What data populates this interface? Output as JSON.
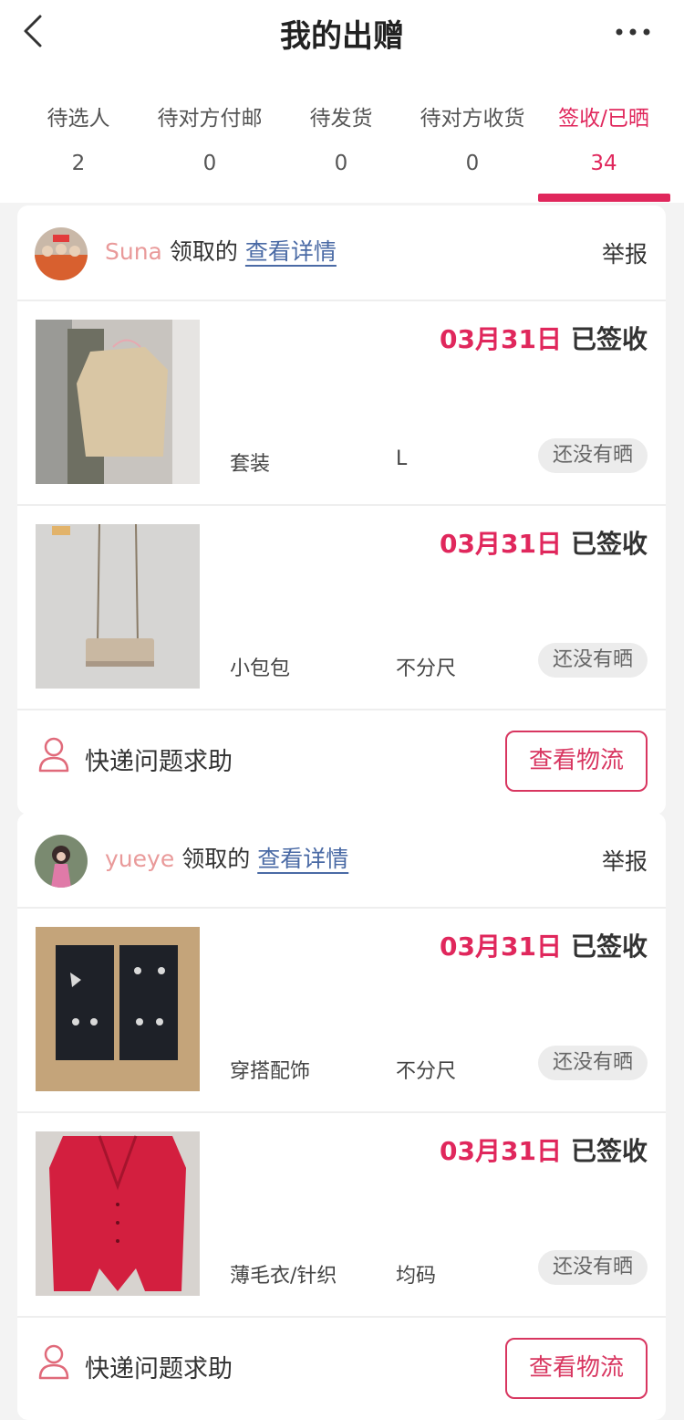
{
  "header": {
    "title": "我的出赠"
  },
  "tabs": [
    {
      "label": "待选人",
      "count": "2"
    },
    {
      "label": "待对方付邮",
      "count": "0"
    },
    {
      "label": "待发货",
      "count": "0"
    },
    {
      "label": "待对方收货",
      "count": "0"
    },
    {
      "label": "签收/已晒",
      "count": "34",
      "active": true
    }
  ],
  "orders": [
    {
      "user": "Suna",
      "received_text": "领取的",
      "detail_link": "查看详情",
      "report": "举报",
      "items": [
        {
          "date": "03月31日",
          "status": "已签收",
          "category": "套装",
          "size": "L",
          "badge": "还没有晒"
        },
        {
          "date": "03月31日",
          "status": "已签收",
          "category": "小包包",
          "size": "不分尺",
          "badge": "还没有晒"
        }
      ],
      "help": "快递问题求助",
      "logistics": "查看物流"
    },
    {
      "user": "yueye",
      "received_text": "领取的",
      "detail_link": "查看详情",
      "report": "举报",
      "items": [
        {
          "date": "03月31日",
          "status": "已签收",
          "category": "穿搭配饰",
          "size": "不分尺",
          "badge": "还没有晒"
        },
        {
          "date": "03月31日",
          "status": "已签收",
          "category": "薄毛衣/针织",
          "size": "均码",
          "badge": "还没有晒"
        }
      ],
      "help": "快递问题求助",
      "logistics": "查看物流"
    }
  ],
  "colors": {
    "accent": "#e0275c",
    "username": "#e99a9a",
    "link": "#4a6aa5"
  }
}
